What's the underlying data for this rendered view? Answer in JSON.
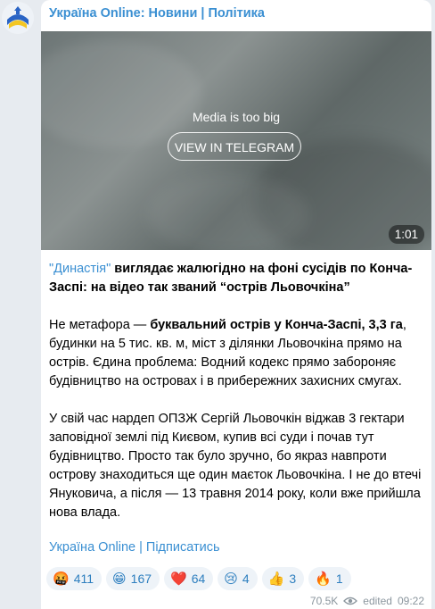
{
  "channel": {
    "name": "Україна Online: Новини | Політика"
  },
  "media": {
    "message": "Media is too big",
    "button_label": "VIEW IN TELEGRAM",
    "duration": "1:01"
  },
  "post": {
    "title_link": "\"Династія\"",
    "title_rest": " виглядає жалюгідно на фоні сусідів по Конча-Заспі: на відео так званий “острів Льовочкіна”",
    "p1_pre": "Не метафора — ",
    "p1_bold": "буквальний острів у Конча-Заспі, 3,3 га",
    "p1_post": ", будинки на 5 тис. кв. м, міст з ділянки Льовочкіна прямо на острів. Єдина проблема: Водний кодекс прямо забороняє будівництво на островах і в прибережних захисних смугах.",
    "p2": "У свій час нардеп ОПЗЖ Сергій Льовочкін віджав 3 гектари заповідної землі під Києвом, купив всі суди і почав тут будівництво. Просто так було зручно, бо якраз навпроти острову знаходиться ще один маєток Льовочкіна. І не до втечі Януковича, а після — 13 травня 2014 року, коли вже прийшла нова влада.",
    "footer_link": "Україна Online | Підписатись"
  },
  "reactions": [
    {
      "emoji": "🤬",
      "count": "411"
    },
    {
      "emoji": "😁",
      "count": "167"
    },
    {
      "emoji": "❤️",
      "count": "64"
    },
    {
      "emoji": "😢",
      "count": "4"
    },
    {
      "emoji": "👍",
      "count": "3"
    },
    {
      "emoji": "🔥",
      "count": "1"
    }
  ],
  "meta": {
    "views": "70.5K",
    "edited": "edited",
    "time": "09:22"
  }
}
